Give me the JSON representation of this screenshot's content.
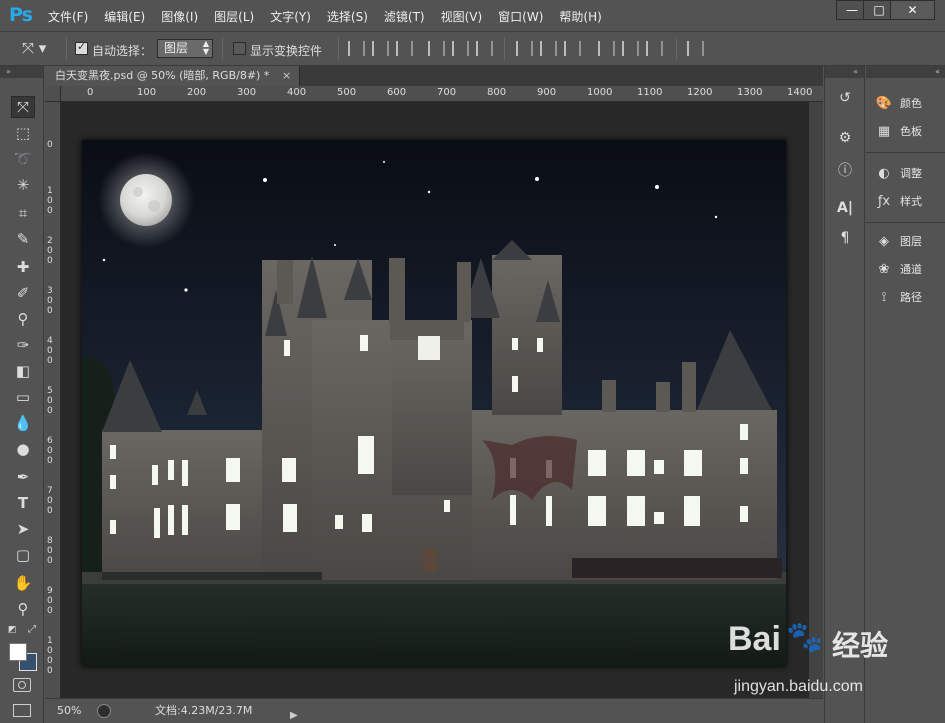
{
  "app": {
    "logo": "Ps",
    "menus": [
      "文件(F)",
      "编辑(E)",
      "图像(I)",
      "图层(L)",
      "文字(Y)",
      "选择(S)",
      "滤镜(T)",
      "视图(V)",
      "窗口(W)",
      "帮助(H)"
    ],
    "window_buttons": {
      "minimize": "—",
      "maximize": "□",
      "close": "✕"
    }
  },
  "options_bar": {
    "auto_select_label": "自动选择：",
    "auto_select_checked": true,
    "auto_select_target": "图层",
    "show_transform_label": "显示变换控件",
    "show_transform_checked": false
  },
  "toolbar": {
    "collapse_label": "»",
    "tools": [
      "move-tool",
      "marquee-tool",
      "lasso-tool",
      "magic-wand-tool",
      "crop-tool",
      "eyedropper-tool",
      "healing-brush-tool",
      "brush-tool",
      "clone-stamp-tool",
      "history-brush-tool",
      "eraser-tool",
      "gradient-tool",
      "blur-tool",
      "dodge-tool",
      "pen-tool",
      "type-tool",
      "path-selection-tool",
      "rectangle-tool",
      "hand-tool",
      "zoom-tool"
    ]
  },
  "document": {
    "tab_title": "白天变黑夜.psd @ 50% (暗部, RGB/8#) *",
    "tab_close": "×",
    "ruler_top": [
      "0",
      "100",
      "200",
      "300",
      "400",
      "500",
      "600",
      "700",
      "800",
      "900",
      "1000",
      "1100",
      "1200",
      "1300",
      "1400"
    ],
    "ruler_left": [
      "0",
      "100",
      "200",
      "300",
      "400",
      "500",
      "600",
      "700",
      "800",
      "900",
      "1000"
    ],
    "zoom": "50%",
    "doc_size": "文档:4.23M/23.7M"
  },
  "right_dock": {
    "collapse_label": "«",
    "panels": [
      {
        "label": "颜色",
        "icon": "palette-icon"
      },
      {
        "label": "色板",
        "icon": "swatches-icon"
      },
      {
        "label": "调整",
        "icon": "adjustments-icon"
      },
      {
        "label": "样式",
        "icon": "styles-icon"
      },
      {
        "label": "图层",
        "icon": "layers-icon"
      },
      {
        "label": "通道",
        "icon": "channels-icon"
      },
      {
        "label": "路径",
        "icon": "paths-icon"
      }
    ]
  },
  "watermark": {
    "brand": "Bai",
    "brand2": "经验",
    "url": "jingyan.baidu.com"
  },
  "colors": {
    "accent": "#29a9e8",
    "ui_bg": "#535353",
    "pasteboard": "#282828"
  }
}
